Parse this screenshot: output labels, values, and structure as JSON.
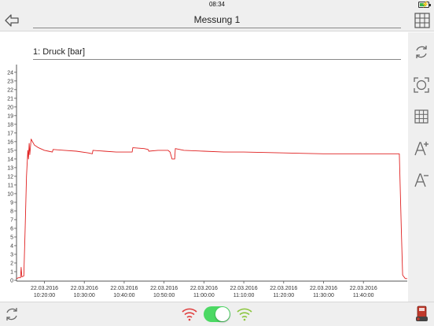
{
  "status": {
    "time": "08:34",
    "battery_level": 0.75
  },
  "navbar": {
    "title": "Messung  1"
  },
  "channel": {
    "label": "1: Druck [bar]"
  },
  "chart_data": {
    "type": "line",
    "title": "",
    "xlabel": "",
    "ylabel": "",
    "ylim": [
      0,
      24.8
    ],
    "y_ticks": [
      "0",
      "1",
      "2",
      "3",
      "4",
      "5",
      "6",
      "7",
      "8",
      "9",
      "10",
      "11",
      "12",
      "13",
      "14",
      "15",
      "16",
      "17",
      "18",
      "19",
      "20",
      "21",
      "22",
      "23",
      "24"
    ],
    "x_ticks": [
      {
        "date": "22.03.2016",
        "time": "10:20:00"
      },
      {
        "date": "22.03.2016",
        "time": "10:30:00"
      },
      {
        "date": "22.03.2016",
        "time": "10:40:00"
      },
      {
        "date": "22.03.2016",
        "time": "10:50:00"
      },
      {
        "date": "22.03.2016",
        "time": "11:00:00"
      },
      {
        "date": "22.03.2016",
        "time": "11:10:00"
      },
      {
        "date": "22.03.2016",
        "time": "11:20:00"
      },
      {
        "date": "22.03.2016",
        "time": "11:30:00"
      },
      {
        "date": "22.03.2016",
        "time": "11:40:00"
      }
    ],
    "xlim": [
      "10:13:00",
      "11:51:00"
    ],
    "grid": false,
    "series": [
      {
        "color": "#e02020",
        "points": [
          [
            "10:13:00",
            0.2
          ],
          [
            "10:13:30",
            0.3
          ],
          [
            "10:14:00",
            0.3
          ],
          [
            "10:14:10",
            1.5
          ],
          [
            "10:14:20",
            0.4
          ],
          [
            "10:14:50",
            0.5
          ],
          [
            "10:15:10",
            6.0
          ],
          [
            "10:15:30",
            12.0
          ],
          [
            "10:15:50",
            15.0
          ],
          [
            "10:16:00",
            14.0
          ],
          [
            "10:16:10",
            15.8
          ],
          [
            "10:16:20",
            14.5
          ],
          [
            "10:16:40",
            16.3
          ],
          [
            "10:17:00",
            16.0
          ],
          [
            "10:17:30",
            15.6
          ],
          [
            "10:18:30",
            15.3
          ],
          [
            "10:20:00",
            15.0
          ],
          [
            "10:21:00",
            14.9
          ],
          [
            "10:22:00",
            14.8
          ],
          [
            "10:22:10",
            15.1
          ],
          [
            "10:25:00",
            15.0
          ],
          [
            "10:28:00",
            14.9
          ],
          [
            "10:31:00",
            14.7
          ],
          [
            "10:32:00",
            14.6
          ],
          [
            "10:32:10",
            15.0
          ],
          [
            "10:35:00",
            14.9
          ],
          [
            "10:38:00",
            14.8
          ],
          [
            "10:42:00",
            14.8
          ],
          [
            "10:42:10",
            15.3
          ],
          [
            "10:45:00",
            15.2
          ],
          [
            "10:46:00",
            15.1
          ],
          [
            "10:46:10",
            14.9
          ],
          [
            "10:48:30",
            15.0
          ],
          [
            "10:51:00",
            15.0
          ],
          [
            "10:51:30",
            14.8
          ],
          [
            "10:52:00",
            14.0
          ],
          [
            "10:52:40",
            14.0
          ],
          [
            "10:52:50",
            15.2
          ],
          [
            "10:55:00",
            15.0
          ],
          [
            "11:00:00",
            14.9
          ],
          [
            "11:05:00",
            14.8
          ],
          [
            "11:10:00",
            14.8
          ],
          [
            "11:20:00",
            14.7
          ],
          [
            "11:30:00",
            14.6
          ],
          [
            "11:42:00",
            14.6
          ],
          [
            "11:49:00",
            14.6
          ],
          [
            "11:49:30",
            6.0
          ],
          [
            "11:49:50",
            0.6
          ],
          [
            "11:50:30",
            0.2
          ],
          [
            "11:51:00",
            0.2
          ]
        ]
      }
    ]
  },
  "icons": {
    "back": "back-arrow-icon",
    "grid": "grid-view-icon",
    "sync": "sync-icon",
    "fit": "zoom-fit-icon",
    "gridlines": "gridlines-icon",
    "font_plus": "font-increase-icon",
    "font_minus": "font-decrease-icon",
    "refresh": "refresh-icon",
    "wifi_red": "wifi-disconnected-icon",
    "wifi_green": "wifi-connected-icon",
    "device": "device-icon"
  },
  "colors": {
    "accent": "#e02020",
    "toggle": "#4cd964",
    "wifi_red": "#e04040",
    "wifi_green": "#8cc63f"
  },
  "toggle": {
    "on": true
  }
}
